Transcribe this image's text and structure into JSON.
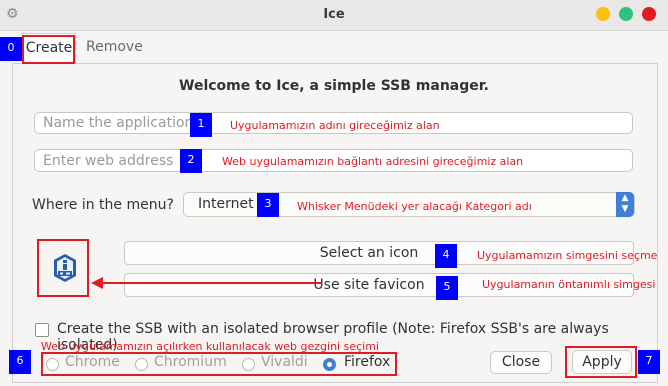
{
  "window": {
    "title": "Ice"
  },
  "tabs": [
    {
      "label": "Create"
    },
    {
      "label": "Remove"
    }
  ],
  "welcome": "Welcome to Ice, a simple SSB manager.",
  "form": {
    "name_placeholder": "Name the application",
    "url_placeholder": "Enter web address",
    "menu_label": "Where in the menu?",
    "menu_value": "Internet",
    "select_icon_label": "Select an icon",
    "favicon_label": "Use site favicon",
    "isolated_label": "Create the SSB with an isolated browser profile (Note: Firefox SSB's are always isolated)",
    "browsers": [
      {
        "label": "Chrome",
        "selected": false
      },
      {
        "label": "Chromium",
        "selected": false
      },
      {
        "label": "Vivaldi",
        "selected": false
      },
      {
        "label": "Firefox",
        "selected": true
      }
    ],
    "close_label": "Close",
    "apply_label": "Apply"
  },
  "annotations": {
    "badges": [
      "0",
      "1",
      "2",
      "3",
      "4",
      "5",
      "6",
      "7"
    ],
    "notes": {
      "name": "Uygulamamızın adını gireceğimiz alan",
      "url": "Web uygulamamızın bağlantı adresini gireceğimiz alan",
      "menu": "Whisker Menüdeki yer alacağı Kategori adı",
      "icon": "Uygulamamızın simgesini seçme",
      "favicon": "Uygulamanın öntanımlı simgesi",
      "browser": "Web uygulamamızın açılırken kullanılacak web gezgini seçimi"
    },
    "color": "#e01b24",
    "badge_color": "#0000ff"
  },
  "accent": "#3d80d4"
}
